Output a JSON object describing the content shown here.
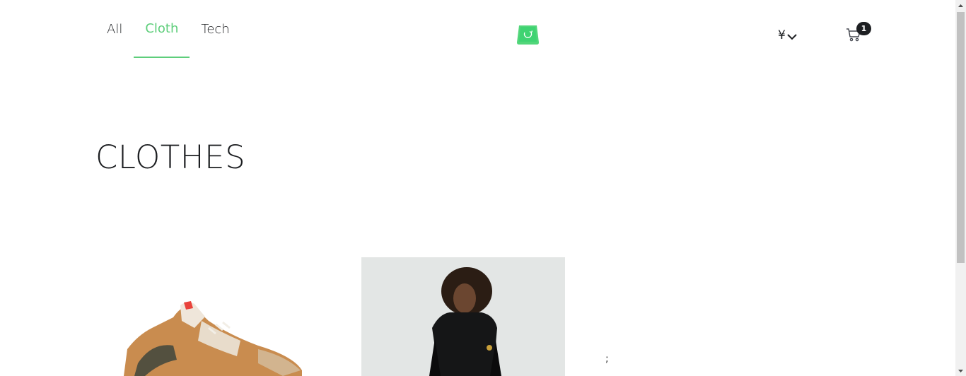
{
  "nav": {
    "items": [
      {
        "label": "All",
        "active": false
      },
      {
        "label": "Cloth",
        "active": true
      },
      {
        "label": "Tech",
        "active": false
      }
    ]
  },
  "brand": {
    "logo_icon": "shopping-bag-logo-icon",
    "accent_color": "#5ece7b"
  },
  "currency": {
    "symbol": "¥",
    "icon": "chevron-down-icon"
  },
  "cart": {
    "count": "1",
    "icon": "cart-icon"
  },
  "page": {
    "title": "CLOTHES"
  },
  "products": [
    {
      "image": "sneaker-product-image"
    },
    {
      "image": "black-jacket-product-image"
    }
  ],
  "stray_text": ";"
}
